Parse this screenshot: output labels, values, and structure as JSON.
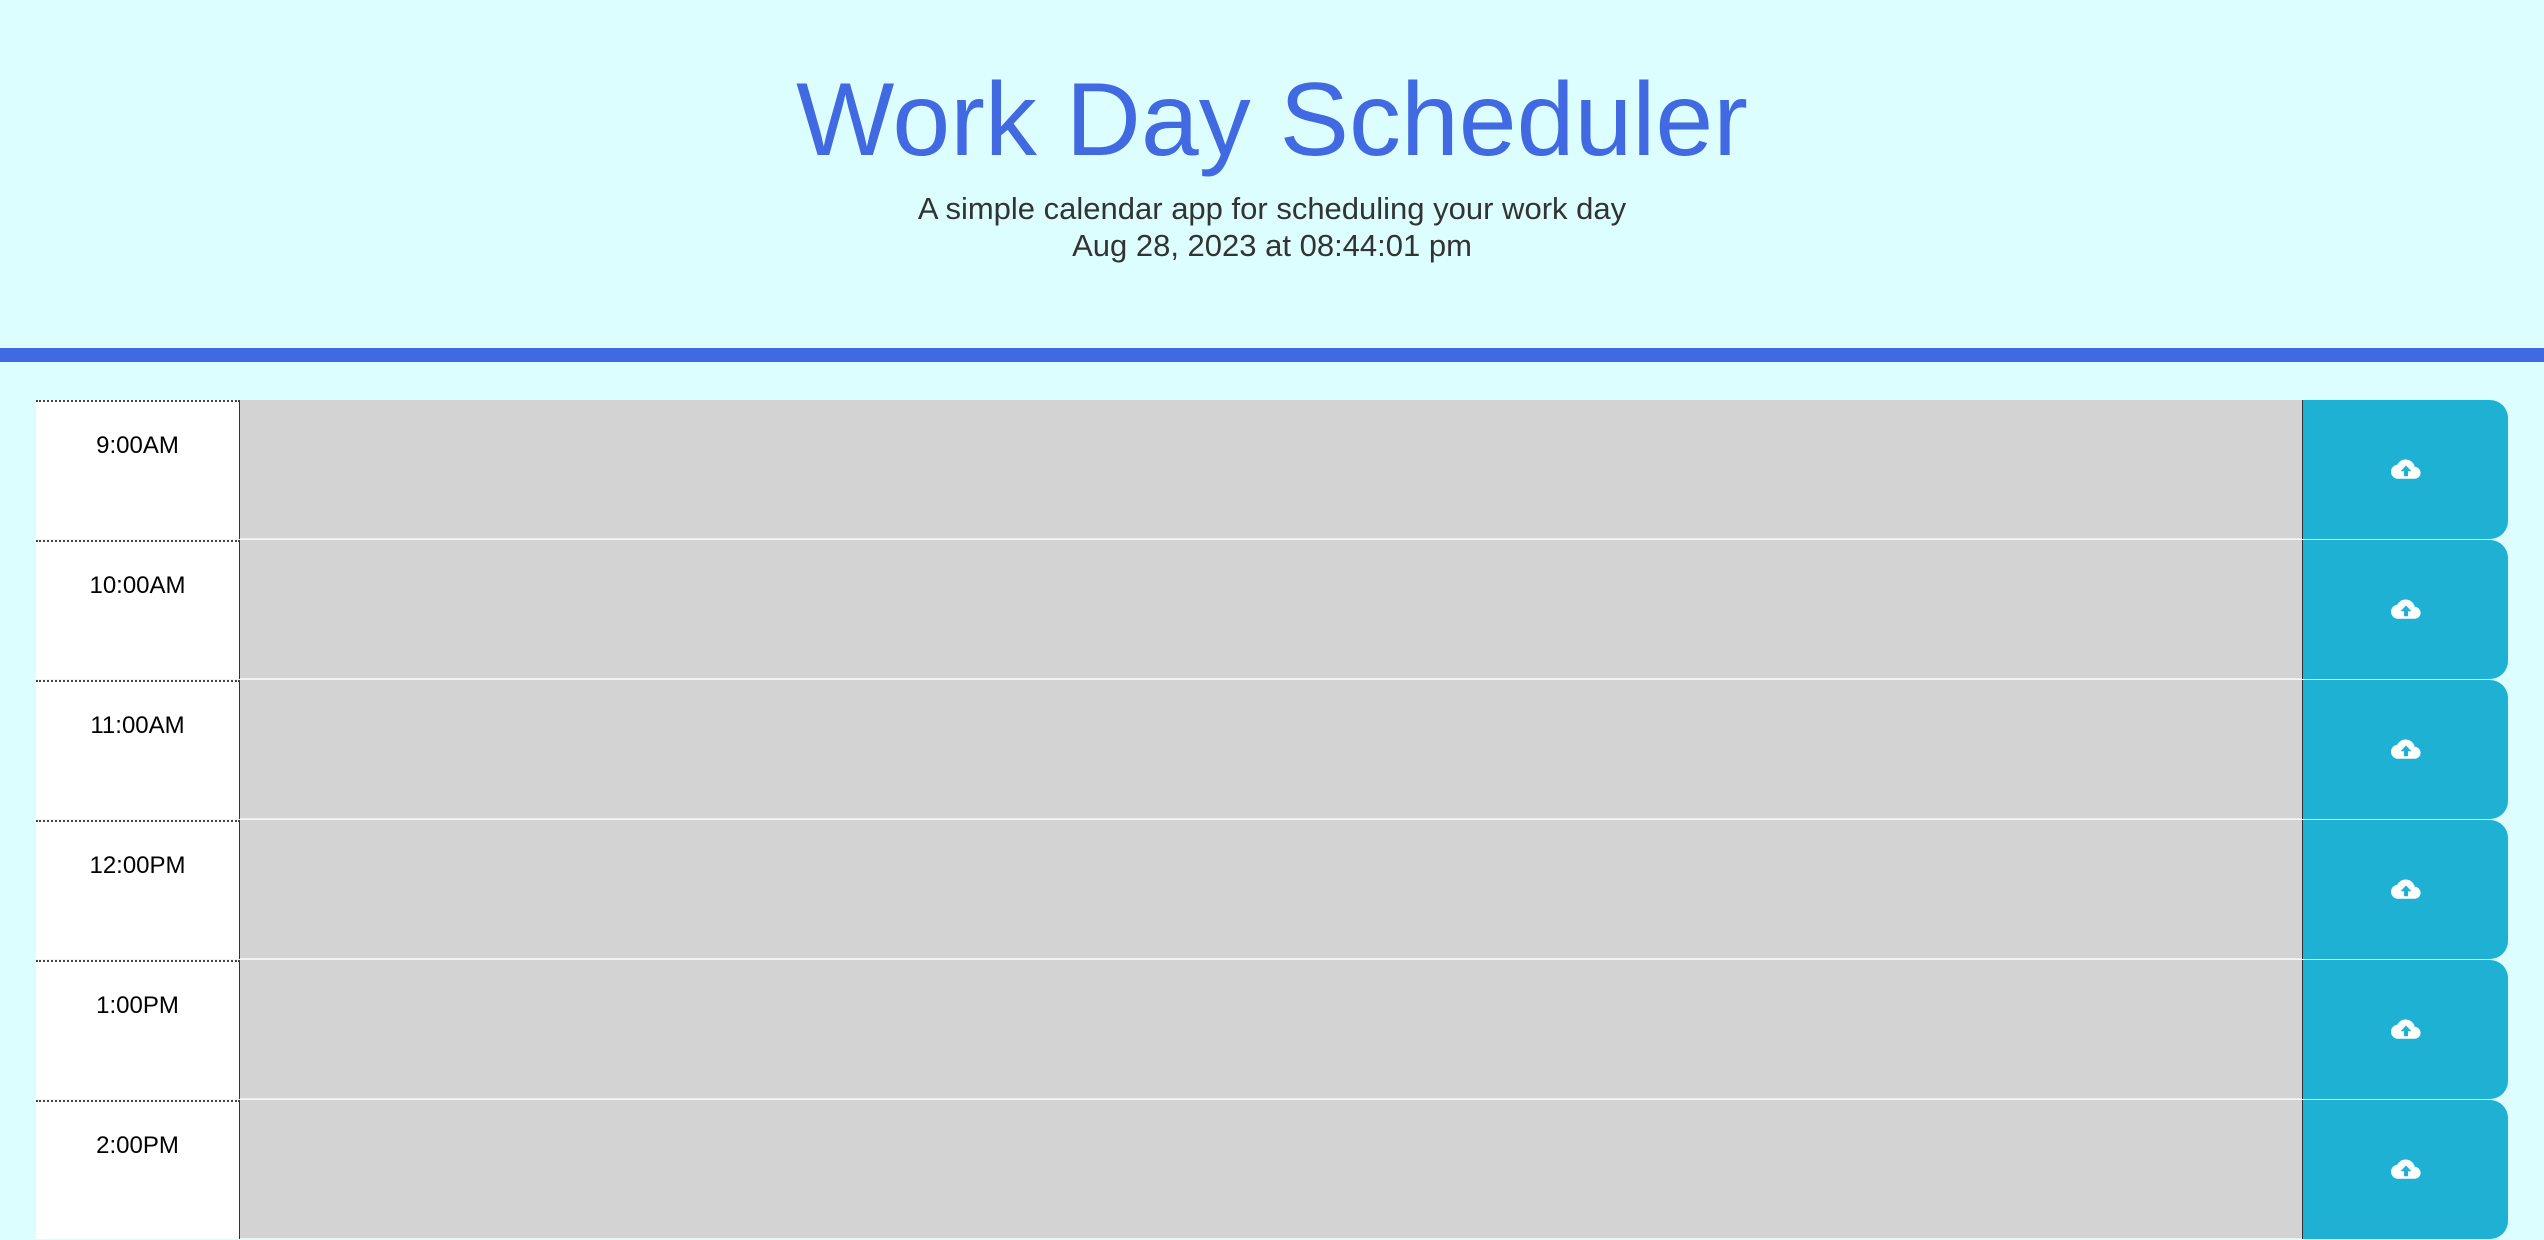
{
  "header": {
    "title": "Work Day Scheduler",
    "subtitle": "A simple calendar app for scheduling your work day",
    "datetime": "Aug 28, 2023 at 08:44:01 pm"
  },
  "colors": {
    "background": "#dcfefe",
    "accent": "#4169e1",
    "past_block": "#d3d3d3",
    "save_button": "#1fb1d4"
  },
  "schedule": {
    "rows": [
      {
        "hour": "9:00AM",
        "description": "",
        "save_icon": "cloud-upload-icon"
      },
      {
        "hour": "10:00AM",
        "description": "",
        "save_icon": "cloud-upload-icon"
      },
      {
        "hour": "11:00AM",
        "description": "",
        "save_icon": "cloud-upload-icon"
      },
      {
        "hour": "12:00PM",
        "description": "",
        "save_icon": "cloud-upload-icon"
      },
      {
        "hour": "1:00PM",
        "description": "",
        "save_icon": "cloud-upload-icon"
      },
      {
        "hour": "2:00PM",
        "description": "",
        "save_icon": "cloud-upload-icon"
      }
    ]
  }
}
